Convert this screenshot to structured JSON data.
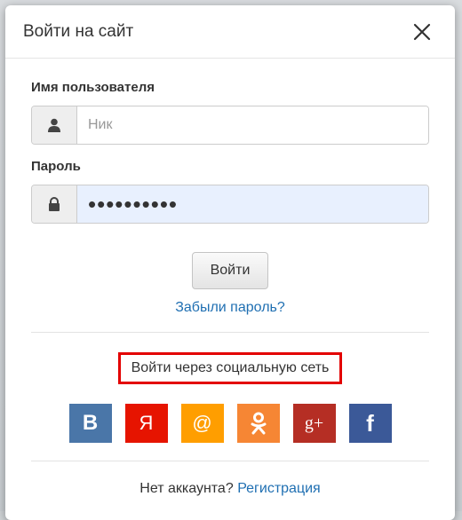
{
  "modal": {
    "title": "Войти на сайт",
    "close_icon": "close-icon"
  },
  "form": {
    "username_label": "Имя пользователя",
    "username_placeholder": "Ник",
    "username_value": "",
    "username_icon": "user-icon",
    "password_label": "Пароль",
    "password_value": "••••••••••",
    "password_icon": "lock-icon",
    "login_button": "Войти",
    "forgot_link": "Забыли пароль?"
  },
  "social": {
    "label": "Войти через социальную сеть",
    "buttons": [
      {
        "name": "vk",
        "glyph": "B",
        "color": "#4a76a8"
      },
      {
        "name": "yandex",
        "glyph": "Я",
        "color": "#e61400"
      },
      {
        "name": "mailru",
        "glyph": "@",
        "color": "#ff9e00"
      },
      {
        "name": "odnoklassniki",
        "glyph": "ok-icon",
        "color": "#f68634"
      },
      {
        "name": "google-plus",
        "glyph": "g+",
        "color": "#b52e24"
      },
      {
        "name": "facebook",
        "glyph": "f",
        "color": "#3b5998"
      }
    ]
  },
  "footer": {
    "question": "Нет аккаунта?",
    "register_link": "Регистрация"
  }
}
